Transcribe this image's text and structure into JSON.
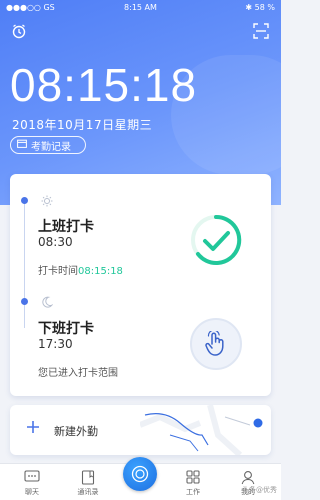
{
  "statusbar": {
    "carrier": "●●●○○ GS",
    "time": "8:15 AM",
    "battery": "✱ 58 %"
  },
  "header": {
    "clock": "08:15:18",
    "date": "2018年10月17日星期三",
    "records_label": "考勤记录"
  },
  "punch_in": {
    "title": "上班打卡",
    "time": "08:30",
    "note_prefix": "打卡时间",
    "note_time": "08:15:18"
  },
  "punch_out": {
    "title": "下班打卡",
    "time": "17:30",
    "note": "您已进入打卡范围"
  },
  "field_out": {
    "label": "新建外勤"
  },
  "tabs": [
    {
      "label": "聊天",
      "icon": "chat-icon"
    },
    {
      "label": "通讯录",
      "icon": "contacts-icon"
    },
    {
      "label": "",
      "icon": "ding-icon"
    },
    {
      "label": "工作",
      "icon": "work-grid-icon"
    },
    {
      "label": "我的",
      "icon": "profile-icon"
    }
  ],
  "watermark": "头条@优秀",
  "colors": {
    "primary": "#4f7ef6",
    "success": "#21c79a",
    "tab_center": "#1f6fe0"
  }
}
